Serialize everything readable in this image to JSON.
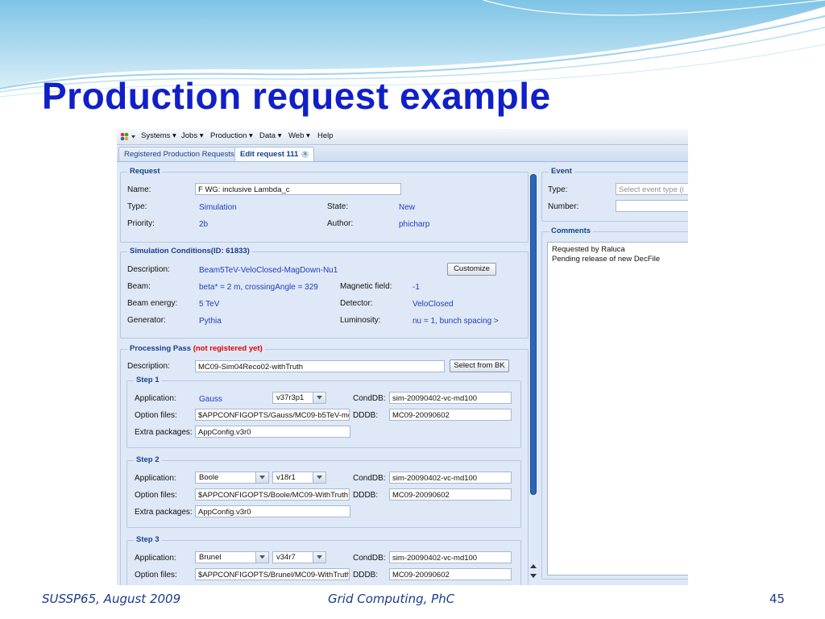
{
  "slide": {
    "title": "Production request example",
    "footer_left": "SUSSP65, August 2009",
    "footer_center": "Grid Computing, PhC",
    "page_number": "45"
  },
  "menu": {
    "items": [
      "Systems ▾",
      "Jobs ▾",
      "Production ▾",
      "Data ▾",
      "Web ▾",
      "Help"
    ]
  },
  "tabs": {
    "registered": "Registered Production Requests",
    "edit": "Edit request 111"
  },
  "request": {
    "legend": "Request",
    "name_label": "Name:",
    "name_value": "F WG: inclusive Lambda_c",
    "type_label": "Type:",
    "type_value": "Simulation",
    "state_label": "State:",
    "state_value": "New",
    "priority_label": "Priority:",
    "priority_value": "2b",
    "author_label": "Author:",
    "author_value": "phicharp"
  },
  "simulation": {
    "legend": "Simulation Conditions(ID: 61833)",
    "description_label": "Description:",
    "description_value": "Beam5TeV-VeloClosed-MagDown-Nu1",
    "customize_button": "Customize",
    "beam_label": "Beam:",
    "beam_value": "beta* = 2 m, crossingAngle = 329",
    "magnetic_label": "Magnetic field:",
    "magnetic_value": "-1",
    "energy_label": "Beam energy:",
    "energy_value": "5 TeV",
    "detector_label": "Detector:",
    "detector_value": "VeloClosed",
    "generator_label": "Generator:",
    "generator_value": "Pythia",
    "luminosity_label": "Luminosity:",
    "luminosity_value": "nu = 1, bunch spacing >"
  },
  "processing": {
    "legend": "Processing Pass",
    "legend_status": "(not registered yet)",
    "description_label": "Description:",
    "description_value": "MC09-Sim04Reco02-withTruth",
    "select_button": "Select from BK",
    "labels": {
      "application": "Application:",
      "option_files": "Option files:",
      "extra_packages": "Extra packages:",
      "conddb": "CondDB:",
      "dddb": "DDDB:"
    },
    "steps": [
      {
        "legend": "Step 1",
        "application": "Gauss",
        "version": "v37r3p1",
        "option_files": "$APPCONFIGOPTS/Gauss/MC09-b5TeV-md",
        "extra_packages": "AppConfig.v3r0",
        "conddb": "sim-20090402-vc-md100",
        "dddb": "MC09-20090602"
      },
      {
        "legend": "Step 2",
        "application": "Boole",
        "version": "v18r1",
        "option_files": "$APPCONFIGOPTS/Boole/MC09-WithTruth",
        "extra_packages": "AppConfig.v3r0",
        "conddb": "sim-20090402-vc-md100",
        "dddb": "MC09-20090602"
      },
      {
        "legend": "Step 3",
        "application": "Brunel",
        "version": "v34r7",
        "option_files": "$APPCONFIGOPTS/Brunel/MC09-WithTruth",
        "conddb": "sim-20090402-vc-md100",
        "dddb": "MC09-20090602"
      }
    ]
  },
  "event": {
    "legend": "Event",
    "type_label": "Type:",
    "type_placeholder": "Select event type (i",
    "number_label": "Number:",
    "number_value": ""
  },
  "comments": {
    "legend": "Comments",
    "line1": "Requested by Raluca",
    "line2": "Pending release of new DecFile"
  },
  "colors": {
    "title": "#1020c8",
    "panel_bg": "#dfe8f6",
    "legend_text": "#15428b",
    "value_text": "#1f3fbf",
    "warning": "#e00000",
    "scroll_thumb": "#2a66b5"
  }
}
